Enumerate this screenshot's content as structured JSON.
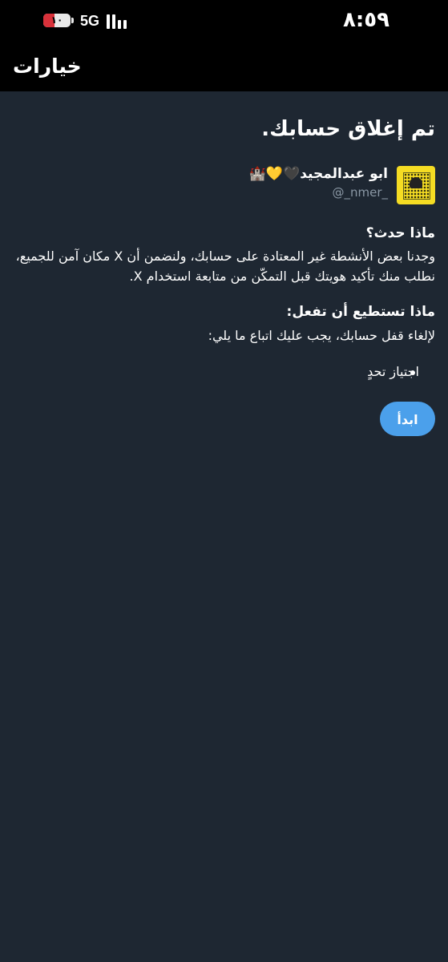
{
  "status_bar": {
    "battery_text": "١٠",
    "battery_level": 0.1,
    "network": "5G",
    "time": "٨:٥٩"
  },
  "app_bar": {
    "title": "خيارات"
  },
  "main": {
    "title": "تم إغلاق حسابك.",
    "user": {
      "name": "ابو عبدالمجيد🖤💛🏰",
      "handle": "@_nmer_"
    },
    "what_happened": {
      "heading": "ماذا حدث؟",
      "text": "وجدنا بعض الأنشطة غير المعتادة على حسابك، ولنضمن أن X مكان آمن للجميع، نطلب منك تأكيد هويتك قبل التمكّن من متابعة استخدام X."
    },
    "what_to_do": {
      "heading": "ماذا تستطيع أن تفعل:",
      "text": "لإلغاء قفل حسابك، يجب عليك اتباع ما يلي:",
      "steps": [
        "اجتياز تحدٍ"
      ]
    },
    "start_button": "ابدأ"
  },
  "colors": {
    "background": "#1e2732",
    "bar": "#000000",
    "accent": "#4ba0eb",
    "muted": "#8b98a5"
  }
}
